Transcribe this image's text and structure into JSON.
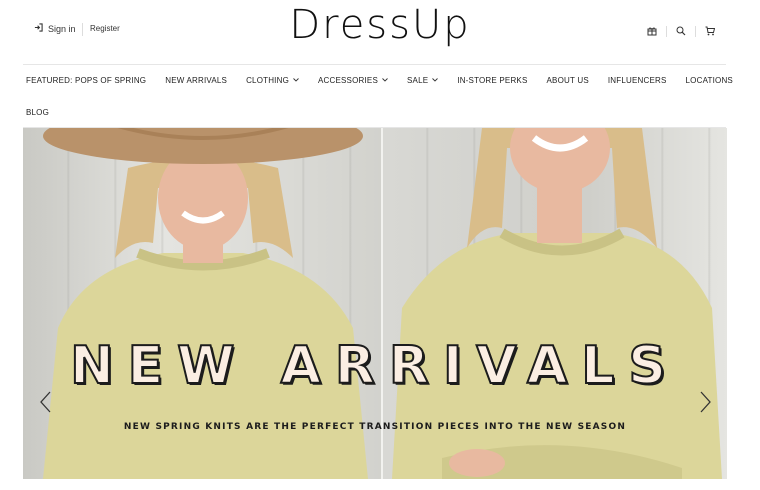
{
  "header": {
    "signin_label": "Sign in",
    "register_label": "Register",
    "logo_text": "DressUp",
    "icons": [
      "gift-icon",
      "search-icon",
      "cart-icon"
    ]
  },
  "nav": {
    "items": [
      {
        "label": "FEATURED: POPS OF SPRING",
        "has_dropdown": false
      },
      {
        "label": "NEW ARRIVALS",
        "has_dropdown": false
      },
      {
        "label": "CLOTHING",
        "has_dropdown": true
      },
      {
        "label": "ACCESSORIES",
        "has_dropdown": true
      },
      {
        "label": "SALE",
        "has_dropdown": true
      },
      {
        "label": "IN-STORE PERKS",
        "has_dropdown": false
      },
      {
        "label": "ABOUT US",
        "has_dropdown": false
      },
      {
        "label": "INFLUENCERS",
        "has_dropdown": false
      },
      {
        "label": "LOCATIONS",
        "has_dropdown": false
      },
      {
        "label": "BLOG",
        "has_dropdown": false
      }
    ]
  },
  "hero": {
    "title": "NEW ARRIVALS",
    "subtitle": "NEW SPRING KNITS ARE THE PERFECT TRANSITION PIECES INTO THE NEW SEASON",
    "colors": {
      "hat": "#b9926a",
      "sweater": "#dcd69a",
      "skin": "#e8b9a0",
      "hair": "#d9bd8a",
      "wall": "#d6d6d2"
    }
  }
}
